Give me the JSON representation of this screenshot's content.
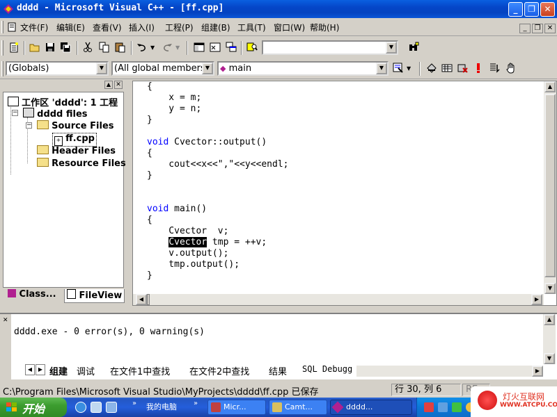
{
  "window": {
    "title": "dddd - Microsoft Visual C++ - [ff.cpp]",
    "min_glyph": "_",
    "restore_glyph": "❐",
    "close_glyph": "✕"
  },
  "menu": {
    "items": [
      "文件(F)",
      "编辑(E)",
      "查看(V)",
      "插入(I)",
      "工程(P)",
      "组建(B)",
      "工具(T)",
      "窗口(W)",
      "帮助(H)"
    ],
    "mdi": [
      "_",
      "❐",
      "✕"
    ]
  },
  "toolbar": {
    "find_value": "",
    "class_combo": "(Globals)",
    "members_combo": "(All global members",
    "function_combo": "main"
  },
  "workspace": {
    "root": "工作区 'dddd': 1 工程",
    "project": "dddd files",
    "source_folder": "Source Files",
    "source_file": "ff.cpp",
    "header_folder": "Header Files",
    "resource_folder": "Resource Files",
    "tabs": [
      "Class...",
      "FileView"
    ]
  },
  "editor": {
    "lines": [
      {
        "t": "{"
      },
      {
        "t": "    x = m;"
      },
      {
        "t": "    y = n;"
      },
      {
        "t": "}"
      },
      {
        "t": ""
      },
      {
        "kw": "void",
        "t": " Cvector::output()"
      },
      {
        "t": "{"
      },
      {
        "t": "    cout<<x<<\",\"<<y<<endl;"
      },
      {
        "t": "}"
      },
      {
        "t": ""
      },
      {
        "t": ""
      },
      {
        "kw": "void",
        "t": " main()"
      },
      {
        "t": "{"
      },
      {
        "t": "    Cvector  v;"
      },
      {
        "pre": "    ",
        "sel": "Cvector",
        "t": " tmp = ++v;"
      },
      {
        "t": "    v.output();"
      },
      {
        "t": "    tmp.output();"
      },
      {
        "t": "}"
      }
    ]
  },
  "output": {
    "text": "dddd.exe - 0 error(s), 0 warning(s)",
    "tabs": [
      "组建",
      "调试",
      "在文件1中查找",
      "在文件2中查找",
      "结果",
      "SQL Debugg"
    ]
  },
  "status": {
    "message": "C:\\Program Files\\Microsoft Visual Studio\\MyProjects\\dddd\\ff.cpp 已保存",
    "position": "行 30, 列 6",
    "rec": "RE"
  },
  "taskbar": {
    "start": "开始",
    "my_computer": "我的电脑",
    "tasks": [
      "Micr...",
      "Camt...",
      "dddd..."
    ],
    "watermark": "灯火互联网",
    "watermark_url": "WWW.ATCPU.COM"
  }
}
